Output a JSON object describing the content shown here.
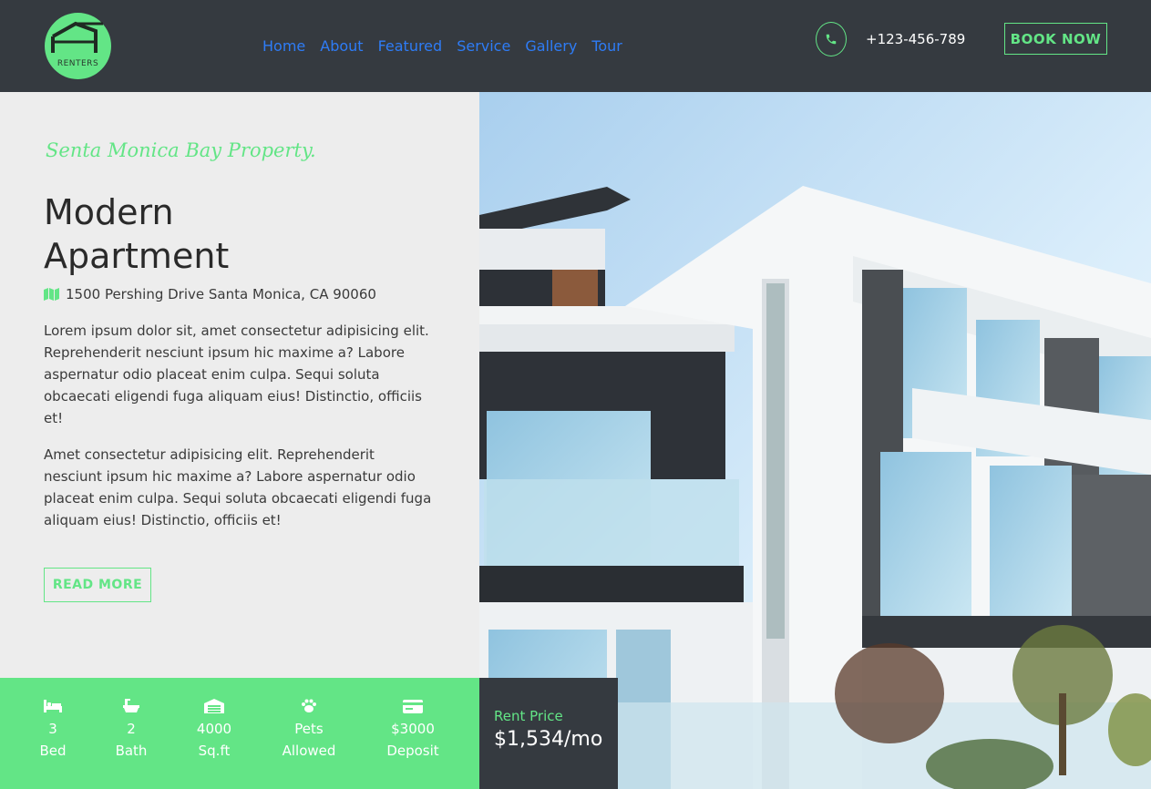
{
  "header": {
    "logo_text": "RENTERS",
    "nav": [
      "Home",
      "About",
      "Featured",
      "Service",
      "Gallery",
      "Tour"
    ],
    "phone": "+123-456-789",
    "book_label": "BOOK NOW"
  },
  "hero": {
    "tagline": "Senta Monica Bay Property.",
    "title_line1": "Modern",
    "title_line2": "Apartment",
    "address": "1500 Pershing Drive Santa Monica, CA 90060",
    "paragraph1": "Lorem ipsum dolor sit, amet consectetur adipisicing elit. Reprehenderit nesciunt ipsum hic maxime a? Labore aspernatur odio placeat enim culpa. Sequi soluta obcaecati eligendi fuga aliquam eius! Distinctio, officiis et!",
    "paragraph2": "Amet consectetur adipisicing elit. Reprehenderit nesciunt ipsum hic maxime a? Labore aspernatur odio placeat enim culpa. Sequi soluta obcaecati eligendi fuga aliquam eius! Distinctio, officiis et!",
    "read_more": "READ MORE"
  },
  "stats": [
    {
      "icon": "bed-icon",
      "value": "3",
      "label": "Bed"
    },
    {
      "icon": "bath-icon",
      "value": "2",
      "label": "Bath"
    },
    {
      "icon": "garage-icon",
      "value": "4000",
      "label": "Sq.ft"
    },
    {
      "icon": "paw-icon",
      "value": "Pets",
      "label": "Allowed"
    },
    {
      "icon": "card-icon",
      "value": "$3000",
      "label": "Deposit"
    }
  ],
  "price": {
    "label": "Rent Price",
    "value": "$1,534/mo"
  },
  "colors": {
    "accent": "#63e586",
    "dark": "#353a40",
    "nav_link": "#2e7cf6",
    "panel": "#ededed"
  }
}
